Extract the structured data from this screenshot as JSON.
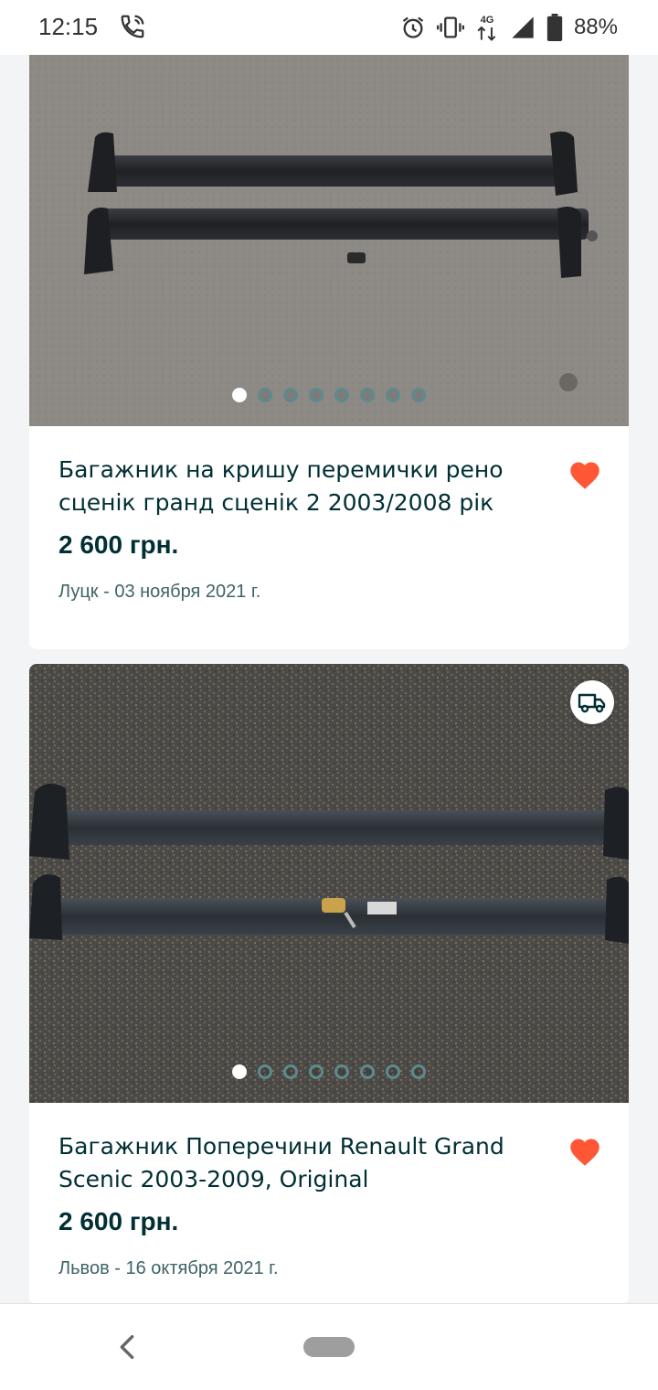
{
  "status_bar": {
    "time": "12:15",
    "battery": "88%",
    "network": "4G"
  },
  "listings": [
    {
      "title": "Багажник на кришу перемички рено сценік гранд сценік 2 2003/2008 рік",
      "price": "2 600 грн.",
      "location_date": "Луцк - 03 ноября 2021 г.",
      "favorited": true,
      "photo_count": 8,
      "active_photo": 1,
      "delivery": false
    },
    {
      "title": "Багажник Поперечини Renault Grand Scenic 2003-2009, Original",
      "price": "2 600 грн.",
      "location_date": "Львов - 16 октября 2021 г.",
      "favorited": true,
      "photo_count": 8,
      "active_photo": 1,
      "delivery": true
    }
  ],
  "colors": {
    "heart": "#ff5636",
    "text_primary": "#002f34",
    "text_secondary": "#406367",
    "page_bg": "#f2f4f5"
  },
  "icons": [
    "phone-call-icon",
    "alarm-icon",
    "vibrate-icon",
    "signal-icon",
    "battery-icon",
    "heart-icon",
    "delivery-truck-icon",
    "back-icon"
  ]
}
